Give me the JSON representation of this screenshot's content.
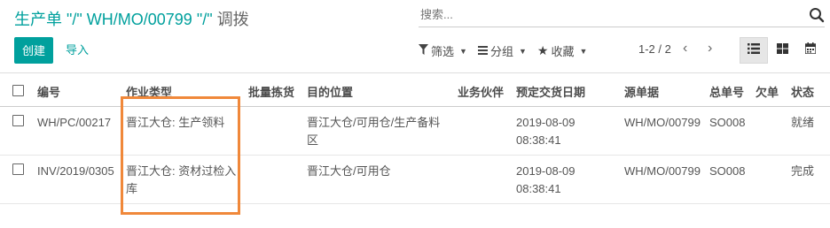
{
  "breadcrumb": {
    "parent": "生产单 \"/\" WH/MO/00799 \"/\"",
    "current": "调拨"
  },
  "search": {
    "placeholder": "搜索..."
  },
  "actions": {
    "create_label": "创建",
    "import_label": "导入"
  },
  "filters": {
    "filter_label": "筛选",
    "group_label": "分组",
    "favorite_label": "收藏"
  },
  "pager": {
    "value": "1-2 / 2"
  },
  "icons": {
    "search": "search-icon",
    "filter": "funnel-icon",
    "group": "list-icon",
    "favorite": "star-icon",
    "prev": "chevron-left-icon",
    "next": "chevron-right-icon",
    "list_view": "list-view-icon",
    "kanban_view": "kanban-view-icon",
    "calendar_view": "calendar-view-icon"
  },
  "colors": {
    "accent": "#00a09d",
    "highlight": "#f0883a"
  },
  "table": {
    "headers": {
      "reference": "编号",
      "operation_type": "作业类型",
      "batch": "批量拣货",
      "destination": "目的位置",
      "partner": "业务伙伴",
      "scheduled_date": "预定交货日期",
      "source": "源单据",
      "backorder_of": "总单号",
      "backorder": "欠单",
      "state": "状态"
    },
    "rows": [
      {
        "reference": "WH/PC/00217",
        "operation_type": "晋江大仓: 生产领料",
        "batch": "",
        "destination": "晋江大仓/可用仓/生产备料区",
        "partner": "",
        "scheduled_date": "2019-08-09 08:38:41",
        "source": "WH/MO/00799",
        "backorder_of": "SO008",
        "backorder": "",
        "state": "就绪"
      },
      {
        "reference": "INV/2019/0305",
        "operation_type": "晋江大仓: 资材过检入库",
        "batch": "",
        "destination": "晋江大仓/可用仓",
        "partner": "",
        "scheduled_date": "2019-08-09 08:38:41",
        "source": "WH/MO/00799",
        "backorder_of": "SO008",
        "backorder": "",
        "state": "完成"
      }
    ]
  }
}
